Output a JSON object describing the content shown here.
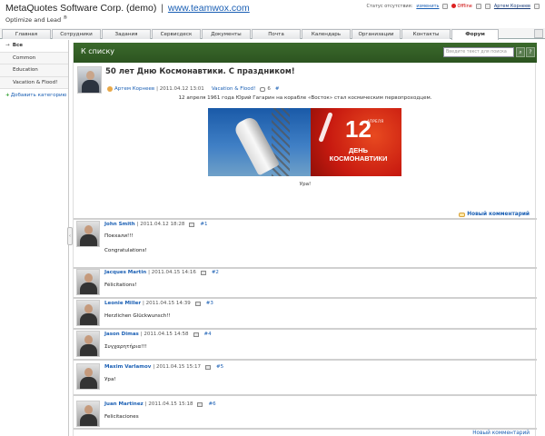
{
  "header": {
    "company": "MetaQuotes Software Corp. (demo)",
    "separator": "|",
    "site_link": "www.teamwox.com",
    "tagline": "Optimize and Lead",
    "tagline_mark": "®",
    "status_text": "Статус отсутствия:",
    "status_change": "изменить",
    "offline": "Offline",
    "user": "Артем Корнеев"
  },
  "tabs": [
    {
      "label": "Главная"
    },
    {
      "label": "Сотрудники"
    },
    {
      "label": "Задания"
    },
    {
      "label": "Сервисдеск"
    },
    {
      "label": "Документы"
    },
    {
      "label": "Почта"
    },
    {
      "label": "Календарь"
    },
    {
      "label": "Организации"
    },
    {
      "label": "Контакты"
    },
    {
      "label": "Форум"
    }
  ],
  "sidebar": {
    "items": [
      {
        "label": "Все",
        "arrow": "→"
      },
      {
        "label": "Common"
      },
      {
        "label": "Education"
      },
      {
        "label": "Vacation & Flood!"
      }
    ],
    "add_category": "Добавить категорию",
    "collapse": "‹"
  },
  "forum_header": {
    "back": "К списку",
    "search_placeholder": "Введите текст для поиска",
    "search_btn": "⌕",
    "help_btn": "?"
  },
  "post": {
    "title": "50 лет Дню Космонавтики. С праздником!",
    "author": "Артем Корнеев",
    "date": "| 2011.04.12 13:01",
    "category": "Vacation & Flood!",
    "comments": "6",
    "hash": "#",
    "text": "12 апреля 1961 года Юрий Гагарин на корабле «Восток» стал космическим первопроходцем.",
    "image_big": "12",
    "image_sub": "АПРЕЛЯ",
    "image_day": "ДЕНЬ КОСМОНАВТИКИ",
    "footer_text": "Ура!"
  },
  "new_comment": "Новый комментарий",
  "comments": [
    {
      "name": "John Smith",
      "date": "| 2011.04.12 18:28",
      "num": "#1",
      "text": "Поехали!!!\n\nCongratulations!"
    },
    {
      "name": "Jacques Martin",
      "date": "| 2011.04.15 14:16",
      "num": "#2",
      "text": "Félicitations!"
    },
    {
      "name": "Leonie Miller",
      "date": "| 2011.04.15 14:39",
      "num": "#3",
      "text": "Herzlichen Glückwunsch!!"
    },
    {
      "name": "Jason Dimas",
      "date": "| 2011.04.15 14:58",
      "num": "#4",
      "text": "Συγχαρητήρια!!!"
    },
    {
      "name": "Maxim Varlamov",
      "date": "| 2011.04.15 15:17",
      "num": "#5",
      "text": "Ура!"
    },
    {
      "name": "Juan Martinez",
      "date": "| 2011.04.15 15:18",
      "num": "#6",
      "text": "Felicitaciones"
    }
  ],
  "bottom_link": "Новый комментарий"
}
